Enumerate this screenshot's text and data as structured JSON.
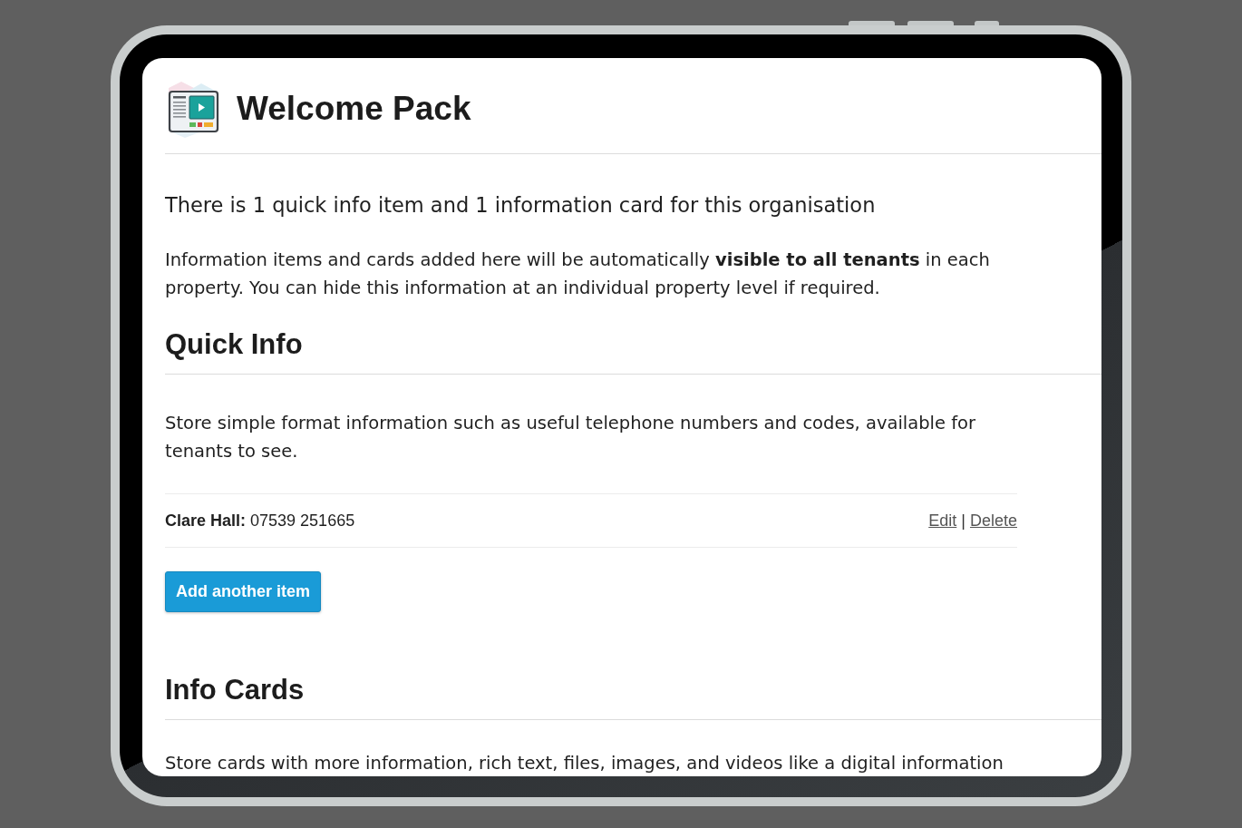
{
  "header": {
    "title": "Welcome Pack"
  },
  "summary": "There is 1 quick info item and 1 information card for this organisation",
  "notice": "Information items and cards added here will be automatically **visible to all tenants** in each property. You can hide this information at an individual property level if required.",
  "sections": [
    {
      "heading": "Quick Info",
      "description": "Store simple format information such as useful telephone numbers and codes, available for tenants to see.",
      "items": [
        {
          "text": "**Clare Hall:** 07539 251665",
          "actions": [
            "Edit",
            "Delete"
          ],
          "separator": "|"
        }
      ],
      "add_button": "Add another item"
    },
    {
      "heading": "Info Cards",
      "description": "Store cards with more information, rich text, files, images, and videos like a digital information"
    }
  ]
}
